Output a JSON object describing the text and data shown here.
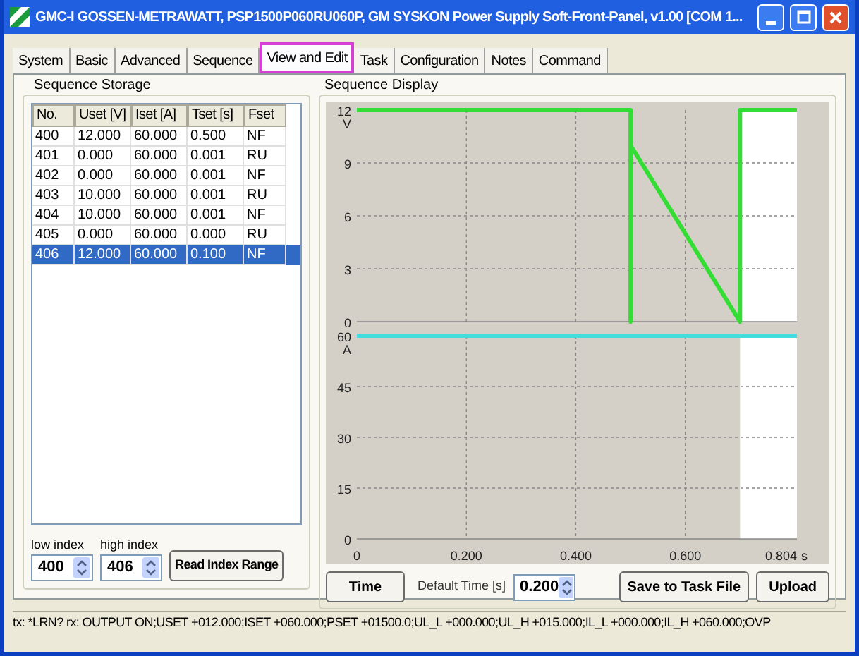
{
  "window": {
    "title": "GMC-I GOSSEN-METRAWATT, PSP1500P060RU060P, GM SYSKON Power Supply Soft-Front-Panel, v1.00 [COM 1..."
  },
  "tabs": [
    {
      "label": "System",
      "selected": false
    },
    {
      "label": "Basic",
      "selected": false
    },
    {
      "label": "Advanced",
      "selected": false
    },
    {
      "label": "Sequence",
      "selected": false
    },
    {
      "label": "View and Edit",
      "selected": true
    },
    {
      "label": "Task",
      "selected": false
    },
    {
      "label": "Configuration",
      "selected": false
    },
    {
      "label": "Notes",
      "selected": false
    },
    {
      "label": "Command",
      "selected": false
    }
  ],
  "sequence_storage": {
    "title": "Sequence Storage",
    "columns": [
      "No.",
      "Uset [V]",
      "Iset [A]",
      "Tset [s]",
      "Fset"
    ],
    "rows": [
      {
        "cells": [
          "400",
          "12.000",
          "60.000",
          "0.500",
          "NF"
        ],
        "selected": false
      },
      {
        "cells": [
          "401",
          "0.000",
          "60.000",
          "0.001",
          "RU"
        ],
        "selected": false
      },
      {
        "cells": [
          "402",
          "0.000",
          "60.000",
          "0.001",
          "NF"
        ],
        "selected": false
      },
      {
        "cells": [
          "403",
          "10.000",
          "60.000",
          "0.001",
          "RU"
        ],
        "selected": false
      },
      {
        "cells": [
          "404",
          "10.000",
          "60.000",
          "0.001",
          "NF"
        ],
        "selected": false
      },
      {
        "cells": [
          "405",
          "0.000",
          "60.000",
          "0.000",
          "RU"
        ],
        "selected": false
      },
      {
        "cells": [
          "406",
          "12.000",
          "60.000",
          "0.100",
          "NF"
        ],
        "selected": true
      }
    ],
    "low_index": {
      "label": "low index",
      "value": "400"
    },
    "high_index": {
      "label": "high index",
      "value": "406"
    },
    "read_button": "Read Index Range"
  },
  "sequence_display": {
    "title": "Sequence Display",
    "voltage_chart": {
      "chart_data": {
        "type": "line",
        "ylabel": "V",
        "x": [
          0,
          0.5,
          0.5,
          0.5,
          0.7,
          0.7,
          0.804
        ],
        "series": [
          {
            "color": "#33dd33",
            "values": [
              12,
              12,
              0,
              10,
              0,
              12,
              12
            ]
          }
        ],
        "xlim": [
          0,
          0.804
        ],
        "ylim": [
          0,
          12
        ],
        "yticks": [
          0,
          3,
          6,
          9,
          12
        ],
        "grid": true,
        "bands": [
          {
            "axis": "x",
            "from": 0.7,
            "to": 0.804,
            "color": "#ffffff"
          }
        ]
      }
    },
    "current_chart": {
      "chart_data": {
        "type": "line",
        "ylabel": "A",
        "xlabel": "s",
        "x": [
          0,
          0.804
        ],
        "series": [
          {
            "color": "#44dddd",
            "values": [
              60,
              60
            ]
          }
        ],
        "xlim": [
          0,
          0.804
        ],
        "ylim": [
          0,
          60
        ],
        "yticks": [
          0,
          15,
          30,
          45,
          60
        ],
        "grid": true,
        "bands": [
          {
            "axis": "x",
            "from": 0.7,
            "to": 0.804,
            "color": "#ffffff"
          }
        ],
        "xticks": [
          {
            "value": 0,
            "label": "0"
          },
          {
            "value": 0.2,
            "label": "0.200"
          },
          {
            "value": 0.4,
            "label": "0.400"
          },
          {
            "value": 0.6,
            "label": "0.600"
          },
          {
            "value": 0.804,
            "label": "0.804"
          }
        ]
      }
    },
    "time_button": "Time",
    "default_time": {
      "label": "Default Time [s]",
      "value": "0.200"
    },
    "save_button": "Save to Task File",
    "upload_button": "Upload"
  },
  "status_bar": "tx: *LRN? rx: OUTPUT ON;USET +012.000;ISET +060.000;PSET +01500.0;UL_L +000.000;UL_H +015.000;IL_L +000.000;IL_H +060.000;OVP"
}
